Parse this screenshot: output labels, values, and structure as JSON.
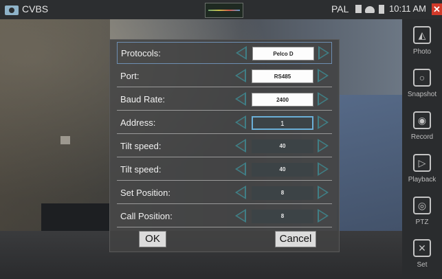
{
  "statusbar": {
    "title": "CVBS",
    "mode": "PAL",
    "time": "10:11 AM",
    "icons": [
      "camera-app-icon",
      "signal-meter-icon",
      "sd-card-icon",
      "wifi-icon",
      "battery-icon",
      "close-icon"
    ]
  },
  "sidebar": {
    "items": [
      {
        "label": "Photo",
        "icon": "photo-icon"
      },
      {
        "label": "Snapshot",
        "icon": "camera-icon"
      },
      {
        "label": "Record",
        "icon": "video-record-icon"
      },
      {
        "label": "Playback",
        "icon": "playback-icon"
      },
      {
        "label": "PTZ",
        "icon": "ptz-camera-icon"
      },
      {
        "label": "Set",
        "icon": "settings-tools-icon"
      }
    ]
  },
  "dialog": {
    "rows": [
      {
        "label": "Protocols:",
        "value": "Pelco D"
      },
      {
        "label": "Port:",
        "value": "RS485"
      },
      {
        "label": "Baud Rate:",
        "value": "2400"
      },
      {
        "label": "Address:",
        "value": "1"
      },
      {
        "label": "Tilt speed:",
        "value": "40"
      },
      {
        "label": "Tilt speed:",
        "value": "40"
      },
      {
        "label": "Set Position:",
        "value": "8"
      },
      {
        "label": "Call Position:",
        "value": "8"
      }
    ],
    "ok_label": "OK",
    "cancel_label": "Cancel"
  }
}
